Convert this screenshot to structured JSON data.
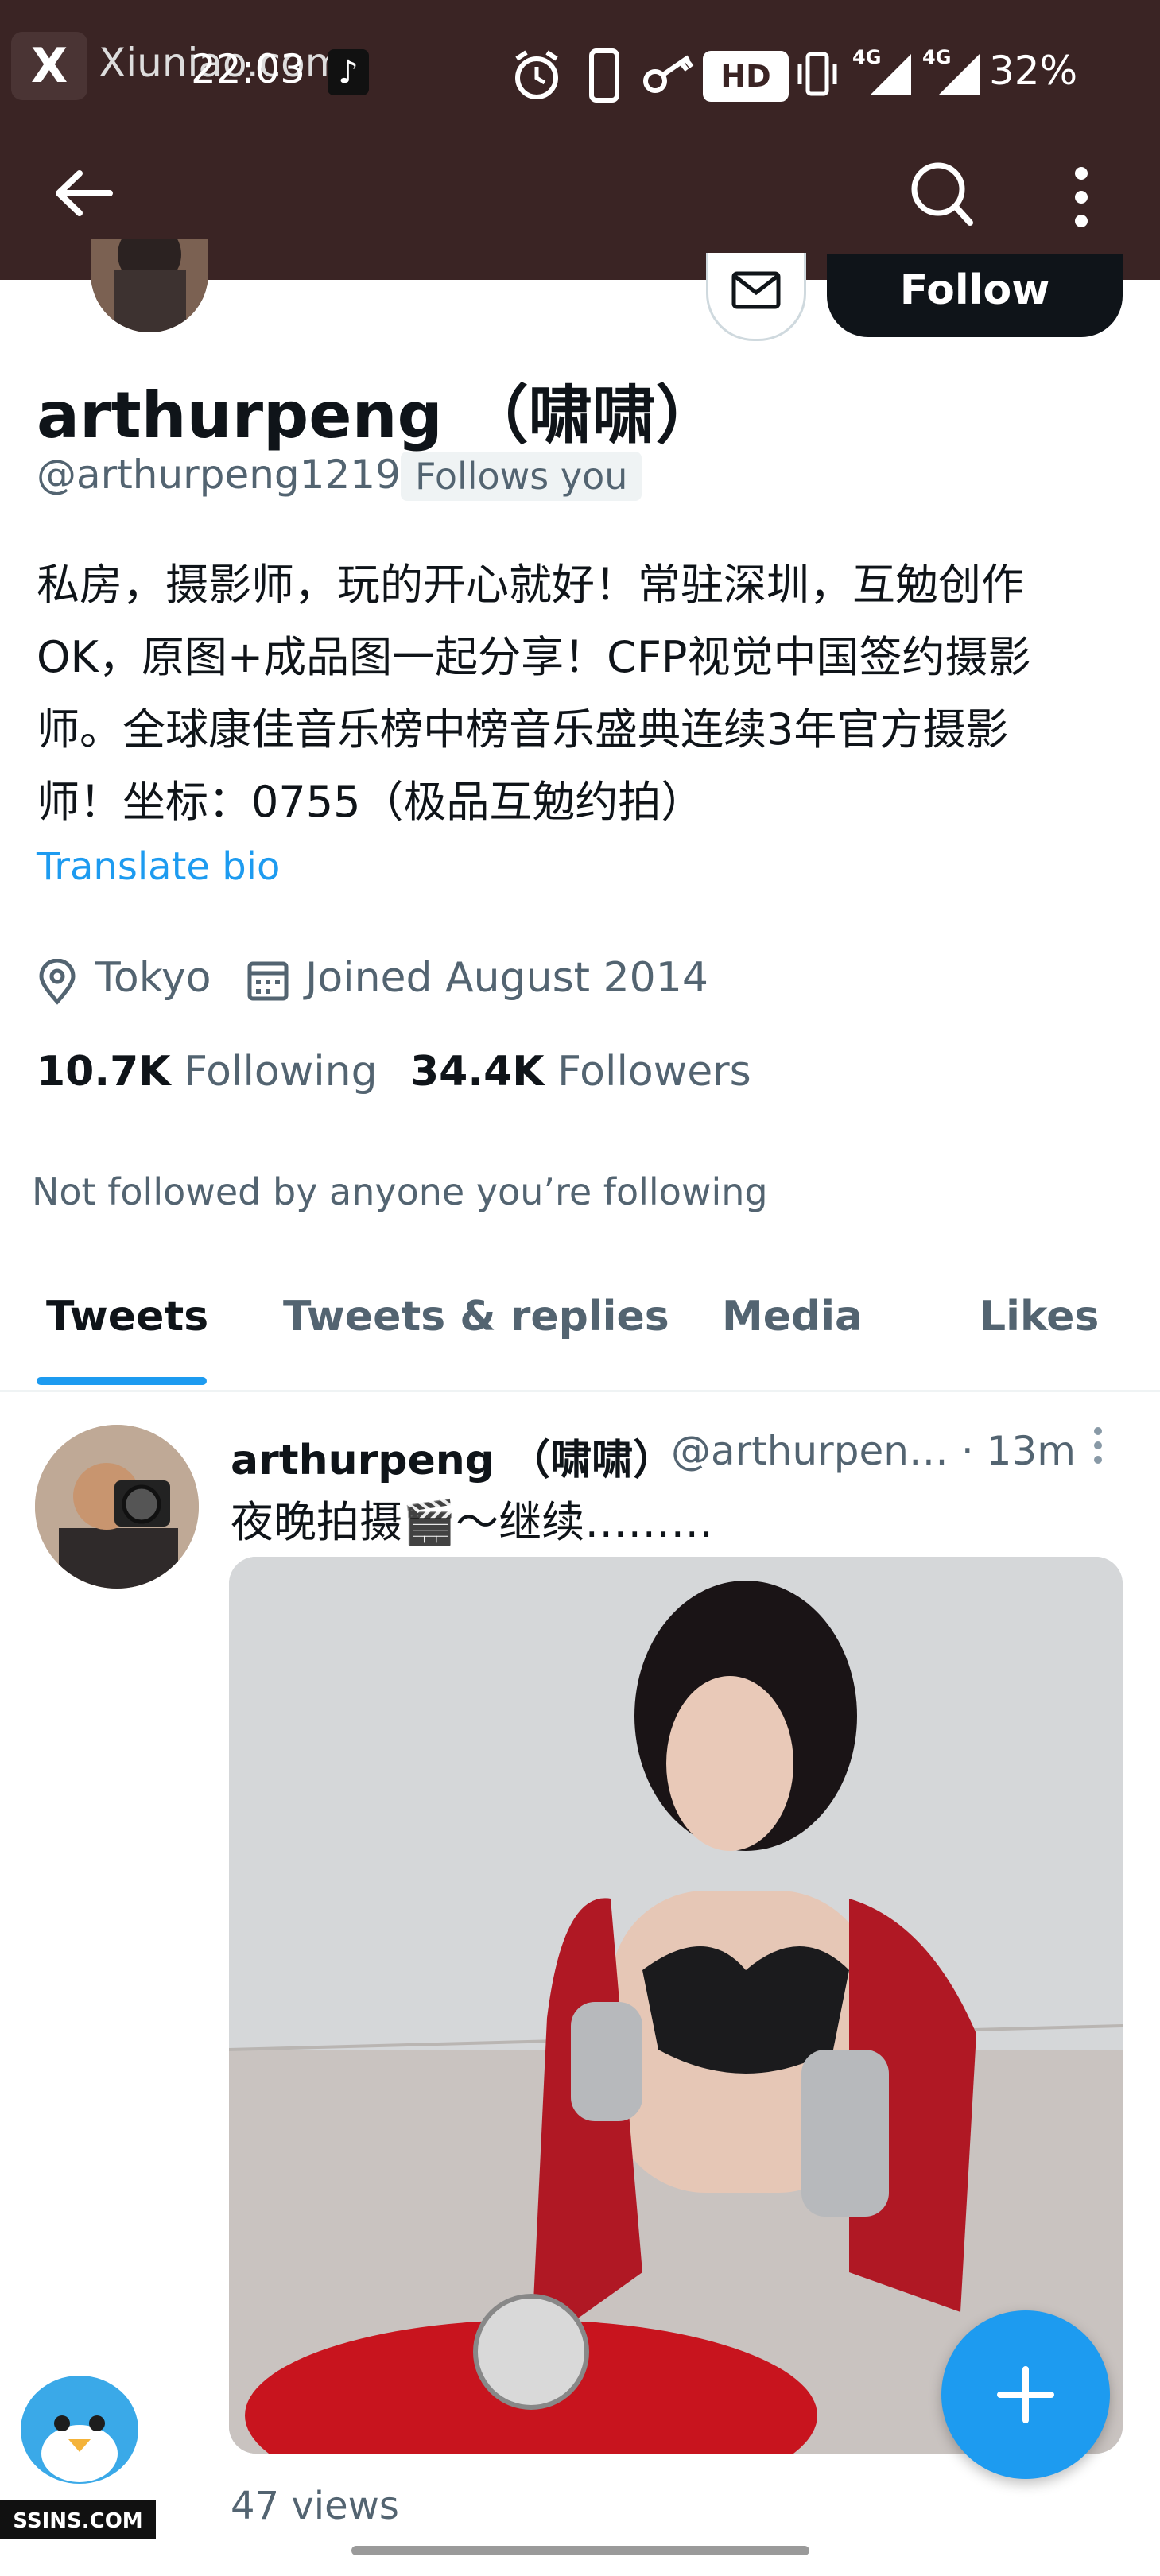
{
  "status_bar": {
    "watermark": "Xiuniao.com",
    "time": "22:03",
    "battery": "32%",
    "network_1": "4G",
    "network_2": "4G",
    "hd_label": "HD",
    "icons": [
      "alarm-icon",
      "phone-icon",
      "key-icon",
      "vibrate-icon",
      "signal-icon",
      "battery-icon",
      "tiktok-icon"
    ]
  },
  "app_bar": {
    "icons": [
      "back-arrow-icon",
      "search-icon",
      "more-vertical-icon"
    ]
  },
  "profile": {
    "follow_label": "Follow",
    "display_name": "arthurpeng （啸啸）",
    "handle": "@arthurpeng1219",
    "follows_you": "Follows you",
    "bio_lines": [
      "私房，摄影师，玩的开心就好！常驻深圳，互勉创作",
      "OK，原图+成品图一起分享！CFP视觉中国签约摄影",
      "师。全球康佳音乐榜中榜音乐盛典连续3年官方摄影",
      "师！坐标：0755（极品互勉约拍）"
    ],
    "translate": "Translate bio",
    "location": "Tokyo",
    "joined": "Joined August 2014",
    "following_count": "10.7K",
    "following_label": "Following",
    "followers_count": "34.4K",
    "followers_label": "Followers",
    "not_followed": "Not followed by anyone you’re following"
  },
  "tabs": [
    {
      "label": "Tweets",
      "active": true
    },
    {
      "label": "Tweets & replies",
      "active": false
    },
    {
      "label": "Media",
      "active": false
    },
    {
      "label": "Likes",
      "active": false
    }
  ],
  "tweet": {
    "name": "arthurpeng （啸啸）",
    "meta": "@arthurpen… · 13m",
    "text": "夜晚拍摄🎬～继续………",
    "views": "47 views"
  },
  "bottom_watermark": "SSINS.COM",
  "colors": {
    "accent": "#1d9bf0",
    "topbar": "#3a2424",
    "text": "#0f1419",
    "secondary": "#536471"
  }
}
